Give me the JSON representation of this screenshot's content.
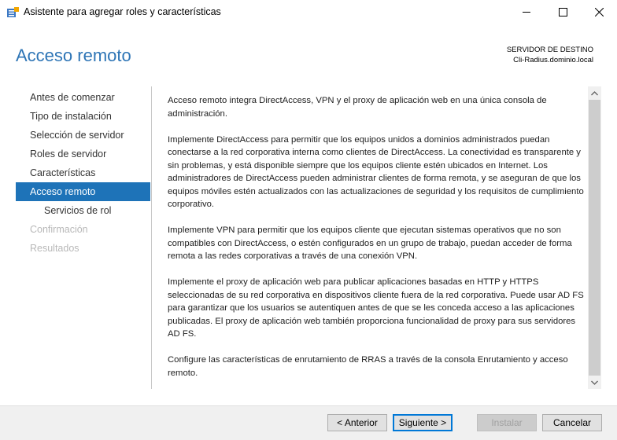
{
  "window": {
    "title": "Asistente para agregar roles y características"
  },
  "page": {
    "title": "Acceso remoto",
    "destination_label": "SERVIDOR DE DESTINO",
    "destination_server": "Cli-Radius.dominio.local"
  },
  "nav": {
    "items": [
      {
        "label": "Antes de comenzar",
        "state": "normal"
      },
      {
        "label": "Tipo de instalación",
        "state": "normal"
      },
      {
        "label": "Selección de servidor",
        "state": "normal"
      },
      {
        "label": "Roles de servidor",
        "state": "normal"
      },
      {
        "label": "Características",
        "state": "normal"
      },
      {
        "label": "Acceso remoto",
        "state": "active"
      },
      {
        "label": "Servicios de rol",
        "state": "sub"
      },
      {
        "label": "Confirmación",
        "state": "disabled"
      },
      {
        "label": "Resultados",
        "state": "disabled"
      }
    ]
  },
  "content": {
    "paragraphs": [
      "Acceso remoto integra DirectAccess, VPN y el proxy de aplicación web en una única consola de administración.",
      "Implemente DirectAccess para permitir que los equipos unidos a dominios administrados puedan conectarse a la red corporativa interna como clientes de DirectAccess. La conectividad es transparente y sin problemas, y está disponible siempre que los equipos cliente estén ubicados en Internet. Los administradores de DirectAccess pueden administrar clientes de forma remota, y se aseguran de que los equipos móviles estén actualizados con las actualizaciones de seguridad y los requisitos de cumplimiento corporativo.",
      "Implemente VPN para permitir que los equipos cliente que ejecutan sistemas operativos que no son compatibles con DirectAccess, o estén configurados en un grupo de trabajo, puedan acceder de forma remota a las redes corporativas a través de una conexión VPN.",
      "Implemente el proxy de aplicación web para publicar aplicaciones basadas en HTTP y HTTPS seleccionadas de su red corporativa en dispositivos cliente fuera de la red corporativa. Puede usar AD FS para garantizar que los usuarios se autentiquen antes de que se les conceda acceso a las aplicaciones publicadas. El proxy de aplicación web también proporciona funcionalidad de proxy para sus servidores AD FS.",
      "Configure las características de enrutamiento de RRAS a través de la consola Enrutamiento y acceso remoto."
    ]
  },
  "footer": {
    "back": "< Anterior",
    "next": "Siguiente >",
    "install": "Instalar",
    "cancel": "Cancelar"
  },
  "colors": {
    "accent": "#1e73b8",
    "title": "#2e75b6"
  }
}
